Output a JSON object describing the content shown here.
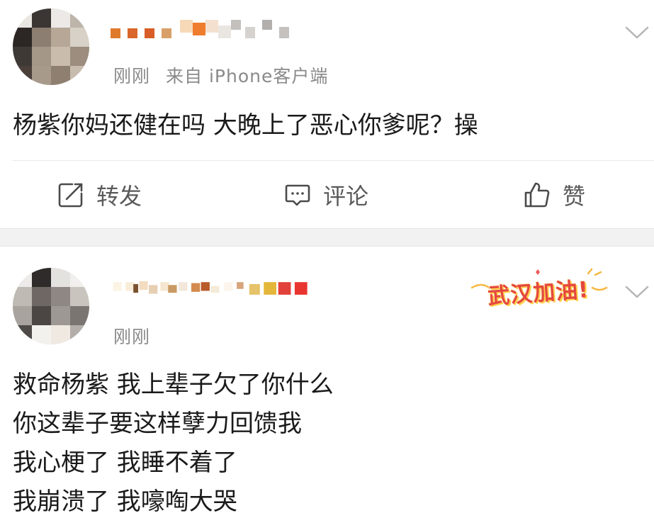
{
  "posts": [
    {
      "time": "刚刚",
      "source": "来自 iPhone客户端",
      "content_lines": [
        "杨紫你妈还健在吗 大晚上了恶心你爹呢？操"
      ],
      "actions": {
        "repost_label": "转发",
        "comment_label": "评论",
        "like_label": "赞"
      },
      "icons": {
        "repost": "repost-icon",
        "comment": "comment-icon",
        "like": "like-icon",
        "menu": "chevron-down-icon"
      }
    },
    {
      "time": "刚刚",
      "badge_text": "武汉加油!",
      "content_lines": [
        "救命杨紫 我上辈子欠了你什么",
        "你这辈子要这样孽力回馈我",
        "我心梗了 我睡不着了",
        "我崩溃了 我嚎啕大哭"
      ],
      "icons": {
        "menu": "chevron-down-icon"
      }
    }
  ],
  "colors": {
    "meta_text": "#8a8a8a",
    "action_text": "#5a5a5a",
    "badge_red": "#e5483f",
    "separator": "#f2f2f2"
  }
}
